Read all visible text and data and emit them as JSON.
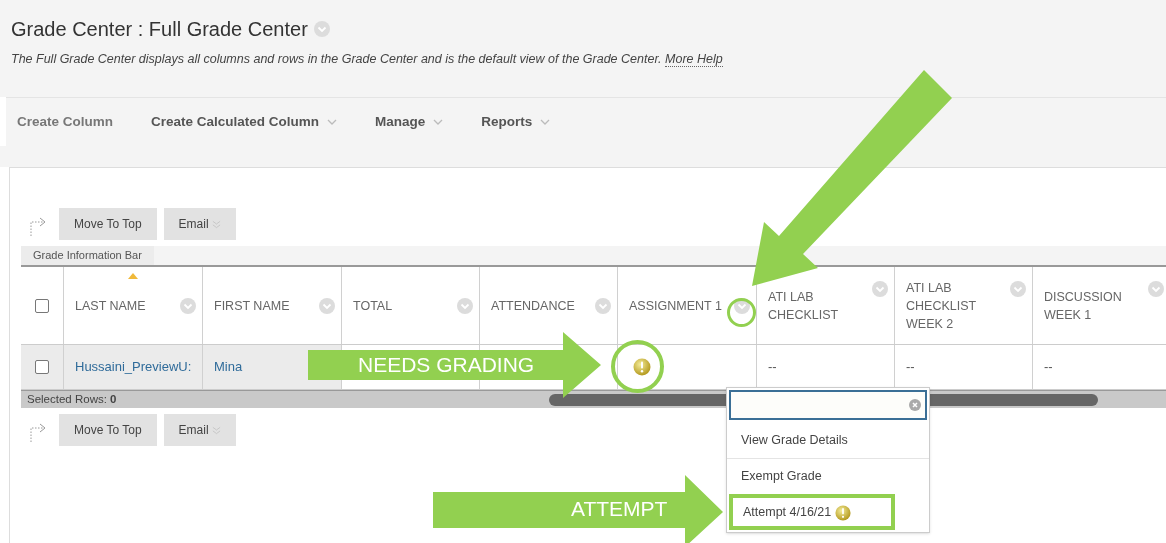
{
  "page": {
    "title": "Grade Center : Full Grade Center",
    "description": "The Full Grade Center displays all columns and rows in the Grade Center and is the default view of the Grade Center.",
    "help_link": "More Help"
  },
  "action_bar": [
    {
      "label": "Create Column",
      "has_menu": false
    },
    {
      "label": "Create Calculated Column",
      "has_menu": true
    },
    {
      "label": "Manage",
      "has_menu": true
    },
    {
      "label": "Reports",
      "has_menu": true
    }
  ],
  "top_toolbar": [
    {
      "label": "Move To Top",
      "has_menu": false
    },
    {
      "label": "Email",
      "has_menu": true
    }
  ],
  "info_bar": "Grade Information Bar",
  "table": {
    "header_checked": false,
    "columns": [
      {
        "label": "LAST NAME",
        "sorted": true
      },
      {
        "label": "FIRST NAME",
        "sorted": false
      },
      {
        "label": "TOTAL",
        "sorted": false
      },
      {
        "label": "ATTENDANCE",
        "sorted": false
      },
      {
        "label": "ASSIGNMENT 1",
        "sorted": false
      },
      {
        "label": "ATI LAB CHECKLIST",
        "sorted": false
      },
      {
        "label": "ATI LAB CHECKLIST WEEK 2",
        "sorted": false
      },
      {
        "label": "DISCUSSION WEEK 1",
        "sorted": false
      }
    ],
    "rows": [
      {
        "checked": false,
        "cells": [
          {
            "kind": "link",
            "text": "Hussaini_PreviewU:"
          },
          {
            "kind": "link",
            "text": "Mina"
          },
          {
            "kind": "empty"
          },
          {
            "kind": "empty"
          },
          {
            "kind": "needs-grading"
          },
          {
            "kind": "text",
            "text": "--"
          },
          {
            "kind": "text",
            "text": "--"
          },
          {
            "kind": "text",
            "text": "--"
          }
        ]
      }
    ]
  },
  "selected_rows": {
    "label": "Selected Rows:",
    "count": "0"
  },
  "bottom_toolbar": [
    {
      "label": "Move To Top",
      "has_menu": false
    },
    {
      "label": "Email",
      "has_menu": true
    }
  ],
  "menu": {
    "items": [
      {
        "label": "View Grade Details",
        "kind": "plain",
        "highlighted": false
      },
      {
        "label": "Exempt Grade",
        "kind": "plain",
        "highlighted": false
      },
      {
        "label": "Attempt 4/16/21",
        "kind": "needs-grading",
        "highlighted": true
      }
    ]
  },
  "callouts": [
    {
      "kind": "needs-grading",
      "text": "NEEDS GRADING"
    },
    {
      "kind": "attempt",
      "text": "ATTEMPT"
    }
  ]
}
